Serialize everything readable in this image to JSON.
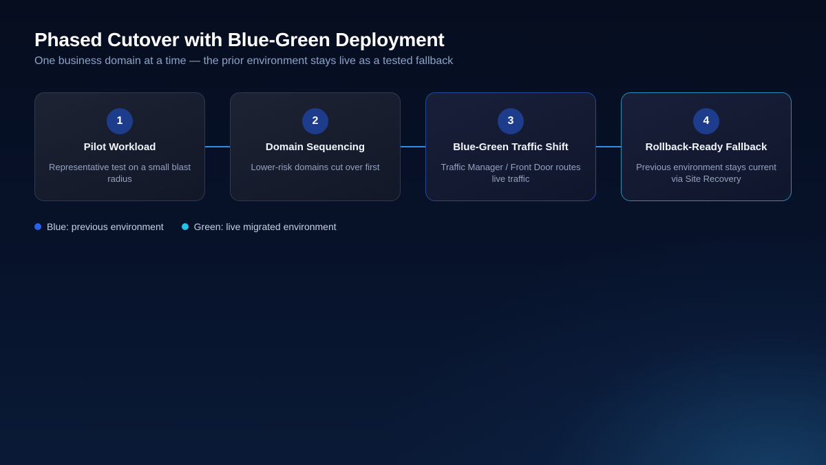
{
  "header": {
    "title": "Phased Cutover with Blue-Green Deployment",
    "subtitle": "One business domain at a time — the prior environment stays live as a tested fallback"
  },
  "steps": [
    {
      "number": "1",
      "title": "Pilot Workload",
      "description": "Representative test on a small blast radius"
    },
    {
      "number": "2",
      "title": "Domain Sequencing",
      "description": "Lower-risk domains cut over first"
    },
    {
      "number": "3",
      "title": "Blue-Green Traffic Shift",
      "description": "Traffic Manager / Front Door routes live traffic"
    },
    {
      "number": "4",
      "title": "Rollback-Ready Fallback",
      "description": "Previous environment stays current via Site Recovery"
    }
  ],
  "legend": [
    {
      "label": "Blue: previous environment",
      "color": "#2563eb"
    },
    {
      "label": "Green: live migrated environment",
      "color": "#22c3e6"
    }
  ],
  "colors": {
    "connector": "#2f8fe6",
    "badge": "#1e3c8c"
  }
}
